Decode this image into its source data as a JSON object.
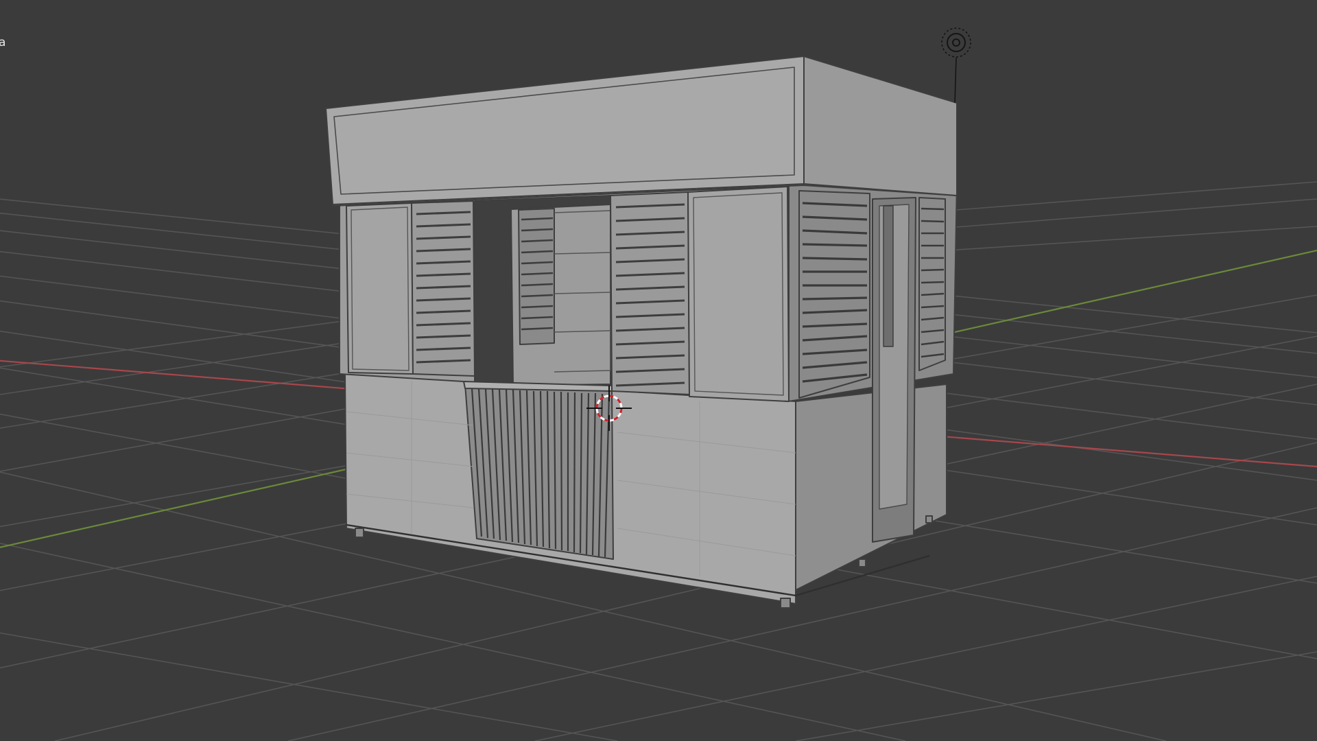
{
  "viewport": {
    "label": "a",
    "background": "#3b3b3b",
    "grid_color": "#555555",
    "x_axis_color": "#a8474c",
    "y_axis_color": "#6b8a3a",
    "model_face_color": "#a6a6a6",
    "model_shade_color": "#8e8e8e",
    "model_edge_color": "#3e3e3e"
  },
  "icons": {
    "light": "light-icon",
    "cursor": "3d-cursor-icon"
  }
}
